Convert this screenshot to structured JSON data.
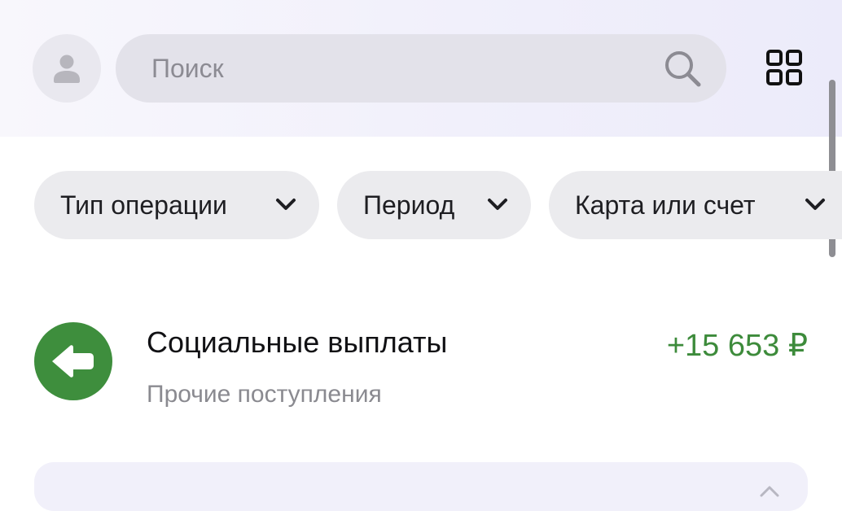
{
  "header": {
    "avatar_icon": "user-icon",
    "search": {
      "placeholder": "Поиск",
      "icon": "search-icon"
    },
    "menu_icon": "grid-icon"
  },
  "filters": [
    {
      "label": "Тип операции",
      "icon": "chevron-down-icon"
    },
    {
      "label": "Период",
      "icon": "chevron-down-icon"
    },
    {
      "label": "Карта или счет",
      "icon": "chevron-down-icon"
    }
  ],
  "operations": [
    {
      "title": "Социальные выплаты",
      "subtitle": "Прочие поступления",
      "amount": "+15 653 ₽",
      "icon": "arrow-left-icon",
      "icon_color": "#3e8e3d",
      "amount_color": "#3d8b3b"
    }
  ],
  "colors": {
    "header_background": "#f1f0fb",
    "chip_background": "#ebebee",
    "income_green": "#3d8b3b"
  }
}
